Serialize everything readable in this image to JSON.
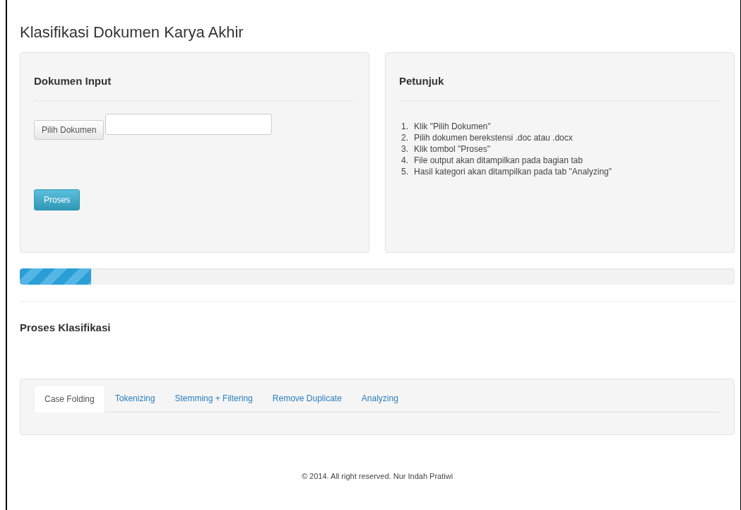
{
  "title": "Klasifikasi Dokumen Karya Akhir",
  "input_panel": {
    "heading": "Dokumen Input",
    "file_button": "Pilih Dokumen",
    "submit_button": "Proses"
  },
  "help_panel": {
    "heading": "Petunjuk",
    "steps": [
      {
        "number": "1.",
        "text": "Klik \"Pilih Dokumen\""
      },
      {
        "number": "2.",
        "text": "Pilih dokumen berekstensi .doc atau .docx"
      },
      {
        "number": "3.",
        "text": "Klik tombol \"Proses\""
      },
      {
        "number": "4.",
        "text": "File output akan ditampilkan pada bagian tab"
      },
      {
        "number": "5.",
        "text": "Hasil kategori akan ditampilkan pada tab \"Analyzing\""
      }
    ]
  },
  "progress": {
    "level": 0.1
  },
  "section_title": "Proses Klasifikasi",
  "tabs": [
    {
      "label": "Case Folding",
      "selected": true
    },
    {
      "label": "Tokenizing",
      "selected": false
    },
    {
      "label": "Stemming + Filtering",
      "selected": false
    },
    {
      "label": "Remove Duplicate",
      "selected": false
    },
    {
      "label": "Analyzing",
      "selected": false
    }
  ],
  "footer": "© 2014. All right reserved. Nur Indah Pratiwi"
}
